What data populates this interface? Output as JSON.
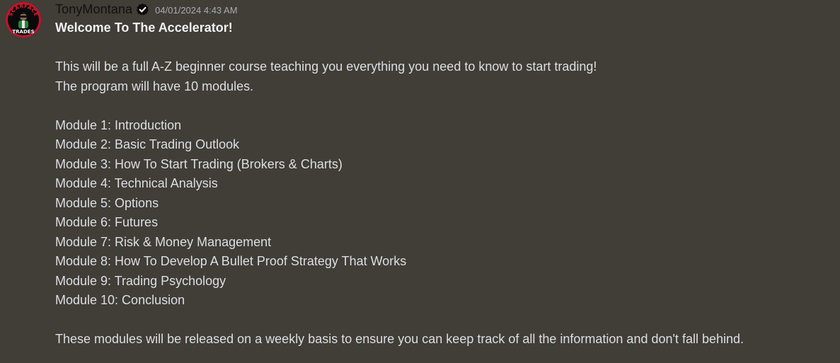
{
  "message": {
    "author": {
      "name": "TonyMontana",
      "verified_icon": "verified-badge-icon",
      "avatar_icon": "scarface-trades-avatar",
      "avatar_text_top": "SCARFACE",
      "avatar_text_bottom": "TRADES"
    },
    "timestamp": "04/01/2024 4:43 AM",
    "title": "Welcome To The Accelerator!",
    "intro": [
      "This will be a full A-Z beginner course teaching you everything you need to know to start trading!",
      "The program will have 10 modules."
    ],
    "modules": [
      "Module 1: Introduction",
      "Module 2: Basic Trading Outlook",
      "Module 3: How To Start Trading (Brokers & Charts)",
      "Module 4: Technical Analysis",
      "Module 5: Options",
      "Module 6: Futures",
      "Module 7: Risk & Money Management",
      "Module 8: How To Develop A Bullet Proof Strategy That Works",
      "Module 9: Trading Psychology",
      "Module 10: Conclusion"
    ],
    "footer": "These modules will be released on a weekly basis to ensure you can keep track of all the information and don't fall behind."
  },
  "colors": {
    "background": "#413d37",
    "text": "#dcdfe4",
    "username": "#111111",
    "timestamp": "#a9acb2",
    "avatar_ring": "#c8102e"
  }
}
